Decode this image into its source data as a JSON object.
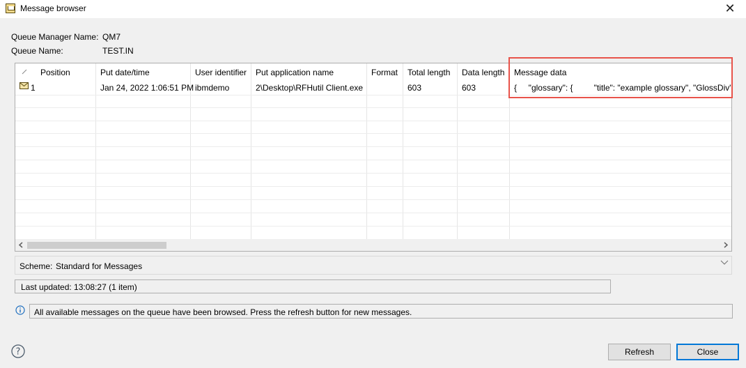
{
  "window": {
    "title": "Message browser",
    "icon": "message-browser-icon",
    "close_glyph": "✕"
  },
  "info": {
    "queue_manager_label": "Queue Manager Name:",
    "queue_manager_value": "QM7",
    "queue_name_label": "Queue Name:",
    "queue_name_value": "TEST.IN"
  },
  "table": {
    "columns": [
      "Position",
      "Put date/time",
      "User identifier",
      "Put application name",
      "Format",
      "Total length",
      "Data length",
      "Message data"
    ],
    "rows": [
      {
        "position": "1",
        "put_datetime": "Jan 24, 2022 1:06:51 PM",
        "user_identifier": "ibmdemo",
        "put_application_name": "2\\Desktop\\RFHutil Client.exe",
        "format": "",
        "total_length": "603",
        "data_length": "603",
        "message_data": "{     \"glossary\": {         \"title\": \"example glossary\", \"GlossDiv\": {"
      }
    ]
  },
  "scheme": {
    "label": "Scheme:",
    "value": "Standard for Messages"
  },
  "status": {
    "last_updated": "Last updated: 13:08:27 (1 item)",
    "message": "All available messages on the queue have been browsed.  Press the refresh button for new messages."
  },
  "buttons": {
    "refresh": "Refresh",
    "close": "Close"
  },
  "colors": {
    "highlight": "#e8534a",
    "primary_button_border": "#0078d7"
  }
}
